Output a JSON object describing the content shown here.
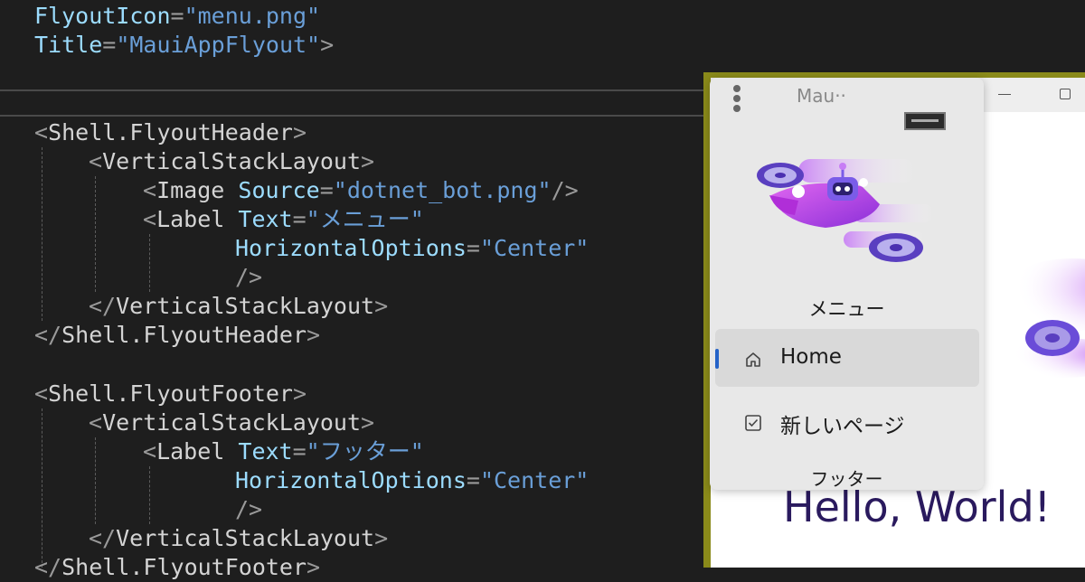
{
  "editor": {
    "lines": [
      [
        {
          "t": "FlyoutIcon",
          "c": "attr"
        },
        {
          "t": "=",
          "c": "punc"
        },
        {
          "t": "\"menu.png\"",
          "c": "str"
        }
      ],
      [
        {
          "t": "Title",
          "c": "attr"
        },
        {
          "t": "=",
          "c": "punc"
        },
        {
          "t": "\"MauiAppFlyout\"",
          "c": "str"
        },
        {
          "t": ">",
          "c": "punc"
        }
      ],
      [
        {
          "t": "<",
          "c": "punc"
        },
        {
          "t": "Shell.FlyoutHeader",
          "c": "tag"
        },
        {
          "t": ">",
          "c": "punc"
        }
      ],
      [
        {
          "t": "<",
          "c": "punc"
        },
        {
          "t": "VerticalStackLayout",
          "c": "tag"
        },
        {
          "t": ">",
          "c": "punc"
        }
      ],
      [
        {
          "t": "<",
          "c": "punc"
        },
        {
          "t": "Image",
          "c": "tag"
        },
        {
          "t": " ",
          "c": "tag"
        },
        {
          "t": "Source",
          "c": "attr"
        },
        {
          "t": "=",
          "c": "punc"
        },
        {
          "t": "\"dotnet_bot.png\"",
          "c": "str"
        },
        {
          "t": "/>",
          "c": "punc"
        }
      ],
      [
        {
          "t": "<",
          "c": "punc"
        },
        {
          "t": "Label",
          "c": "tag"
        },
        {
          "t": " ",
          "c": "tag"
        },
        {
          "t": "Text",
          "c": "attr"
        },
        {
          "t": "=",
          "c": "punc"
        },
        {
          "t": "\"メニュー\"",
          "c": "str"
        }
      ],
      [
        {
          "t": "HorizontalOptions",
          "c": "attr"
        },
        {
          "t": "=",
          "c": "punc"
        },
        {
          "t": "\"Center\"",
          "c": "str"
        }
      ],
      [
        {
          "t": "/>",
          "c": "punc"
        }
      ],
      [
        {
          "t": "</",
          "c": "punc"
        },
        {
          "t": "VerticalStackLayout",
          "c": "tag"
        },
        {
          "t": ">",
          "c": "punc"
        }
      ],
      [
        {
          "t": "</",
          "c": "punc"
        },
        {
          "t": "Shell.FlyoutHeader",
          "c": "tag"
        },
        {
          "t": ">",
          "c": "punc"
        }
      ],
      [
        {
          "t": "<",
          "c": "punc"
        },
        {
          "t": "Shell.FlyoutFooter",
          "c": "tag"
        },
        {
          "t": ">",
          "c": "punc"
        }
      ],
      [
        {
          "t": "<",
          "c": "punc"
        },
        {
          "t": "VerticalStackLayout",
          "c": "tag"
        },
        {
          "t": ">",
          "c": "punc"
        }
      ],
      [
        {
          "t": "<",
          "c": "punc"
        },
        {
          "t": "Label",
          "c": "tag"
        },
        {
          "t": " ",
          "c": "tag"
        },
        {
          "t": "Text",
          "c": "attr"
        },
        {
          "t": "=",
          "c": "punc"
        },
        {
          "t": "\"フッター\"",
          "c": "str"
        }
      ],
      [
        {
          "t": "HorizontalOptions",
          "c": "attr"
        },
        {
          "t": "=",
          "c": "punc"
        },
        {
          "t": "\"Center\"",
          "c": "str"
        }
      ],
      [
        {
          "t": "/>",
          "c": "punc"
        }
      ],
      [
        {
          "t": "</",
          "c": "punc"
        },
        {
          "t": "VerticalStackLayout",
          "c": "tag"
        },
        {
          "t": ">",
          "c": "punc"
        }
      ],
      [
        {
          "t": "</",
          "c": "punc"
        },
        {
          "t": "Shell.FlyoutFooter",
          "c": "tag"
        },
        {
          "t": ">",
          "c": "punc"
        }
      ]
    ]
  },
  "app": {
    "title": "Mau··",
    "page_text": "Hello, World!",
    "flyout": {
      "header_label": "メニュー",
      "items": [
        {
          "label": "Home",
          "icon": "home-icon",
          "selected": true
        },
        {
          "label": "新しいページ",
          "icon": "checkbox-icon",
          "selected": false
        }
      ],
      "footer_label": "フッター"
    }
  },
  "colors": {
    "editor_bg": "#1e1e1e",
    "attribute": "#9cdcfe",
    "string": "#6a9fd8",
    "selection_indicator": "#2563c8",
    "window_border": "#8a8a1a"
  }
}
